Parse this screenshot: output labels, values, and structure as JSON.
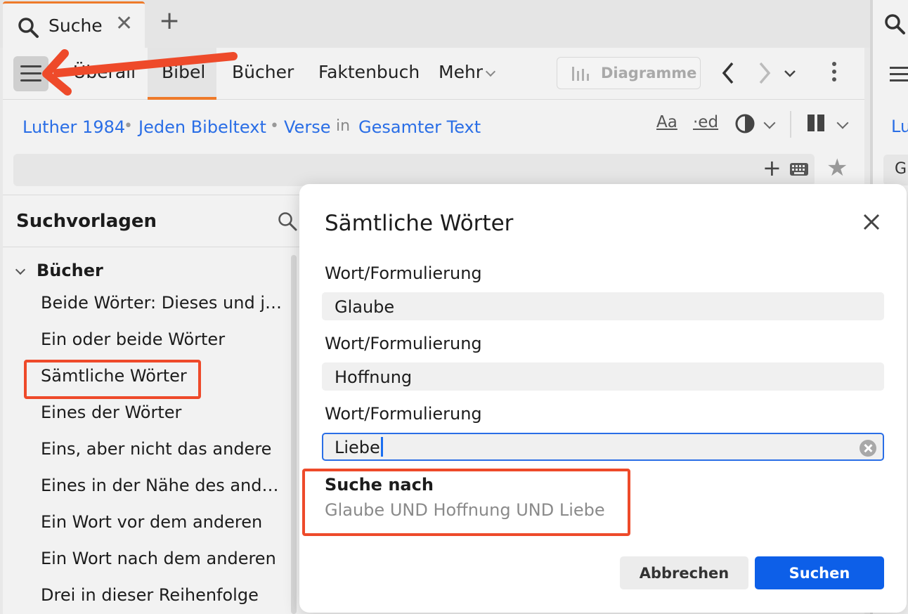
{
  "tabs": [
    {
      "label": "Suche",
      "close_icon": "close-icon"
    }
  ],
  "add_tab_icon": "plus-icon",
  "toolbar": {
    "nav": [
      "Überall",
      "Bibel",
      "Bücher",
      "Faktenbuch",
      "Mehr"
    ],
    "active_nav": "Bibel",
    "chart_button": "Diagramme"
  },
  "filters": {
    "version": "Luther 1984",
    "scope": "Jeden Bibeltext",
    "unit": "Verse",
    "in_label": "in",
    "range": "Gesamter Text",
    "format_aa": "Aa",
    "format_ed": "·ed"
  },
  "right_panel": {
    "crumb": "Lu",
    "field": "G"
  },
  "sidebar": {
    "title": "Suchvorlagen",
    "group": "Bücher",
    "items": [
      "Beide Wörter: Dieses und je…",
      "Ein oder beide Wörter",
      "Sämtliche Wörter",
      "Eines der Wörter",
      "Eins, aber nicht das andere",
      "Eines in der Nähe des ander…",
      "Ein Wort vor dem anderen",
      "Ein Wort nach dem anderen",
      "Drei in dieser Reihenfolge"
    ]
  },
  "dialog": {
    "title": "Sämtliche Wörter",
    "fields": [
      {
        "label": "Wort/Formulierung",
        "value": "Glaube"
      },
      {
        "label": "Wort/Formulierung",
        "value": "Hoffnung"
      },
      {
        "label": "Wort/Formulierung",
        "value": "Liebe"
      }
    ],
    "result_title": "Suche nach",
    "result_text": "Glaube UND Hoffnung UND Liebe",
    "cancel": "Abbrechen",
    "submit": "Suchen"
  },
  "colors": {
    "accent": "#0d5fe8",
    "link": "#2a6ee6",
    "tab_accent": "#ee7a2a",
    "annotation": "#ee4a2a"
  }
}
